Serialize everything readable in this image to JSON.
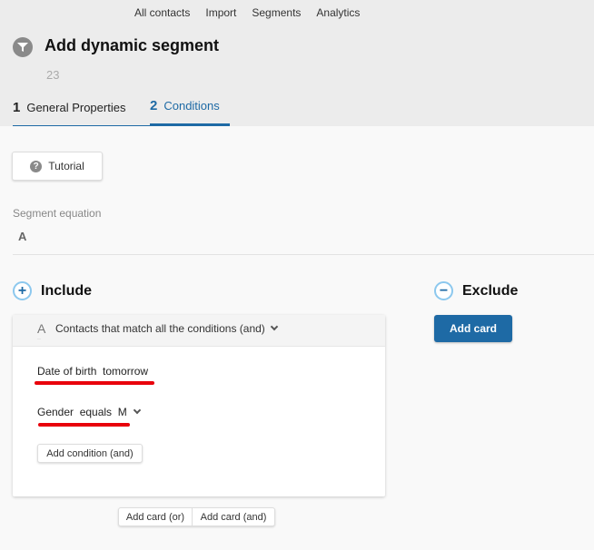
{
  "topnav": [
    "All contacts",
    "Import",
    "Segments",
    "Analytics"
  ],
  "header": {
    "icon": "funnel-icon",
    "title": "Add dynamic segment",
    "subtitle": "23"
  },
  "tabs": [
    {
      "num": "1",
      "label": "General Properties",
      "active": false
    },
    {
      "num": "2",
      "label": "Conditions",
      "active": true
    }
  ],
  "tutorial": {
    "icon": "question-icon",
    "label": "Tutorial"
  },
  "equation": {
    "label": "Segment equation",
    "value": "A"
  },
  "include": {
    "icon": "plus-icon",
    "label": "Include",
    "card": {
      "letter": "A",
      "letter_sub": "::",
      "mode": "Contacts that match all the conditions (and)",
      "conditions": [
        {
          "text": "Date of birth  tomorrow",
          "has_dropdown": false
        },
        {
          "text": "Gender  equals  M",
          "has_dropdown": true
        }
      ],
      "add_condition": "Add condition (and)"
    },
    "add_card_or": "Add card (or)",
    "add_card_and": "Add card (and)"
  },
  "exclude": {
    "icon": "minus-icon",
    "label": "Exclude",
    "add_card": "Add card"
  },
  "colors": {
    "accent": "#1e6aa5",
    "annotation": "#e8000b",
    "header_bg": "#ececec",
    "content_bg": "#f9f9f9"
  }
}
